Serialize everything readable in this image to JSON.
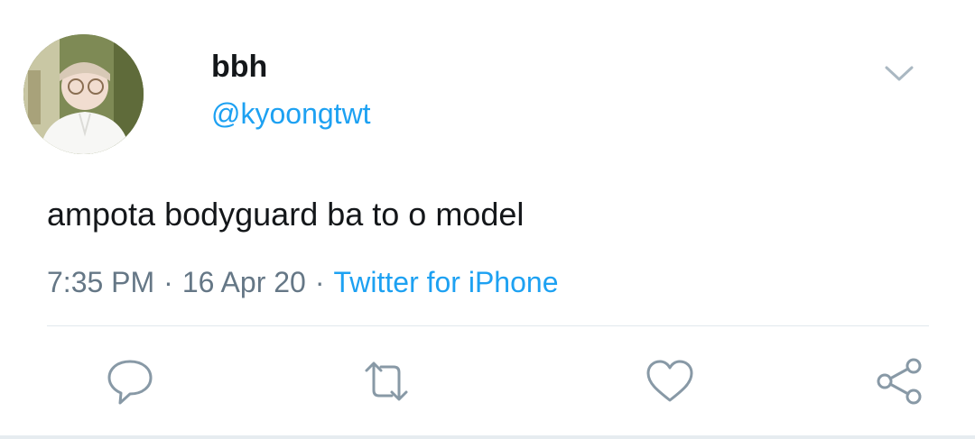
{
  "tweet": {
    "display_name": "bbh",
    "handle": "@kyoongtwt",
    "text": "ampota bodyguard ba to o model",
    "time": "7:35 PM",
    "date": "16 Apr 20",
    "separator": "·",
    "source": "Twitter for iPhone"
  },
  "icons": {
    "menu": "chevron-down-icon",
    "reply": "reply-icon",
    "retweet": "retweet-icon",
    "like": "heart-icon",
    "share": "share-icon"
  },
  "colors": {
    "text": "#14171a",
    "secondary": "#657786",
    "accent": "#1da1f2",
    "icon": "#8899a6",
    "divider": "#e1e8ed"
  }
}
